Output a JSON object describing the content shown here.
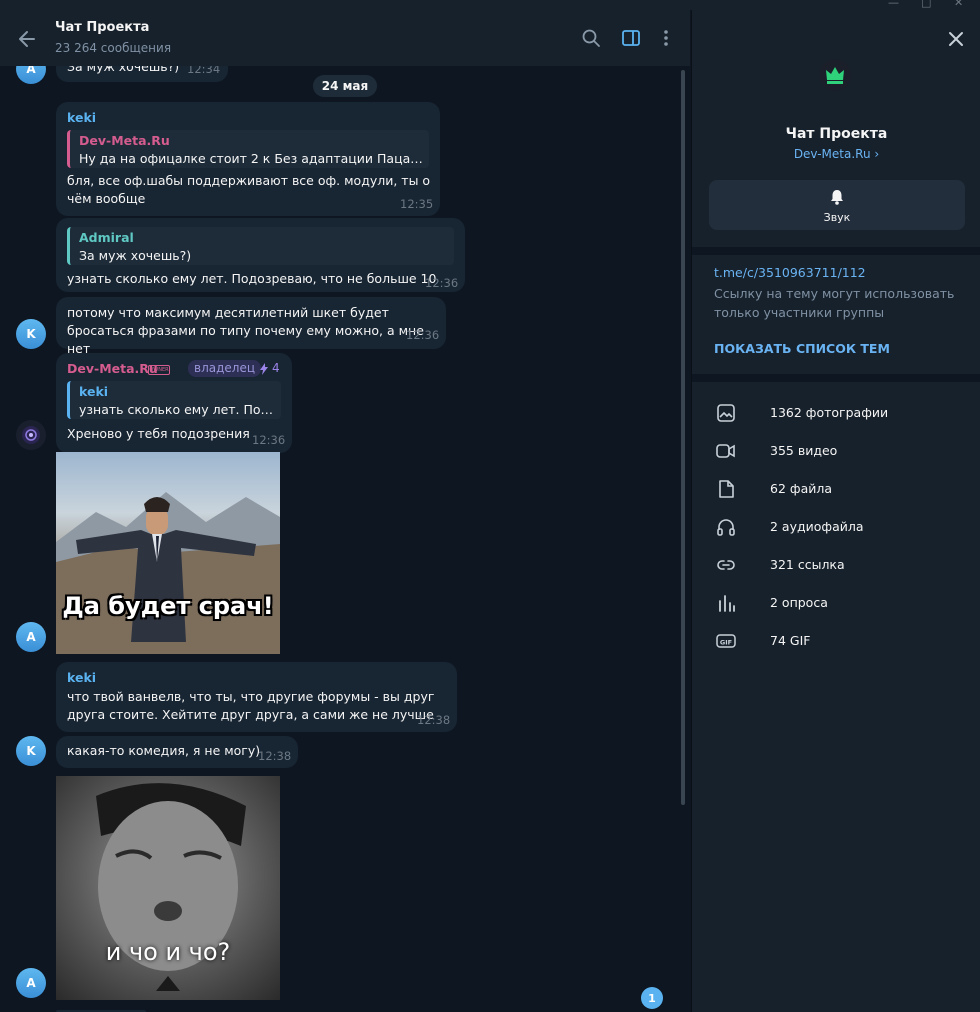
{
  "header": {
    "title": "Чат Проекта",
    "subtitle": "23 264 сообщения"
  },
  "date_pill": "24 мая",
  "messages": {
    "m0": {
      "text": "За муж хочешь?)",
      "time": "12:34",
      "avatar": "A"
    },
    "m1": {
      "sender": "keki",
      "reply_name": "Dev-Meta.Ru",
      "reply_text": "Ну да на офицалке стоит 2 к  Без адаптации  Пацан пр...",
      "text": "бля, все оф.шабы поддерживают все оф. модули, ты о чём вообще",
      "time": "12:35"
    },
    "m2": {
      "reply_name": "Admiral",
      "reply_text": "За муж хочешь?)",
      "text": "узнать сколько ему лет. Подозреваю, что не больше 10",
      "time": "12:36"
    },
    "m3": {
      "text": "потому что максимум десятилетний шкет будет бросаться фразами по типу почему ему можно, а мне нет",
      "time": "12:36",
      "avatar": "K"
    },
    "m4": {
      "sender": "Dev-Meta.Ru",
      "role": "владелец",
      "boost": "4",
      "reply_name": "keki",
      "reply_text": "узнать сколько ему лет. Подо...",
      "text": "Хреново у тебя подозрения",
      "time": "12:36"
    },
    "m5": {
      "caption": "Да будет срач!",
      "avatar": "A"
    },
    "m6": {
      "sender": "keki",
      "text": "что твой ванвелв, что ты, что другие форумы - вы друг друга стоите. Хейтите друг друга, а сами же не лучше",
      "time": "12:38"
    },
    "m7": {
      "text": "какая-то комедия, я не могу)",
      "time": "12:38",
      "avatar": "K"
    },
    "m8": {
      "caption": "и чо и чо?",
      "avatar": "A"
    }
  },
  "unread_badge": "1",
  "panel": {
    "title": "Чат Проекта",
    "link": "Dev-Meta.Ru ›",
    "sound_label": "Звук",
    "topic_link": "t.me/c/3510963711/112",
    "topic_desc": "Ссылку на тему могут использовать только участники группы",
    "show_topics": "ПОКАЗАТЬ СПИСОК ТЕМ",
    "media": [
      {
        "label": "1362 фотографии",
        "icon": "photo-icon"
      },
      {
        "label": "355 видео",
        "icon": "video-icon"
      },
      {
        "label": "62 файла",
        "icon": "file-icon"
      },
      {
        "label": "2 аудиофайла",
        "icon": "headphones-icon"
      },
      {
        "label": "321 ссылка",
        "icon": "link-icon"
      },
      {
        "label": "2 опроса",
        "icon": "poll-icon"
      },
      {
        "label": "74 GIF",
        "icon": "gif-icon"
      }
    ]
  },
  "colors": {
    "accent": "#6ab3f3",
    "bubble": "#182533",
    "sender_pink": "#d45c8e",
    "sender_blue": "#5ab3f0",
    "sender_teal": "#5fc8c3"
  }
}
